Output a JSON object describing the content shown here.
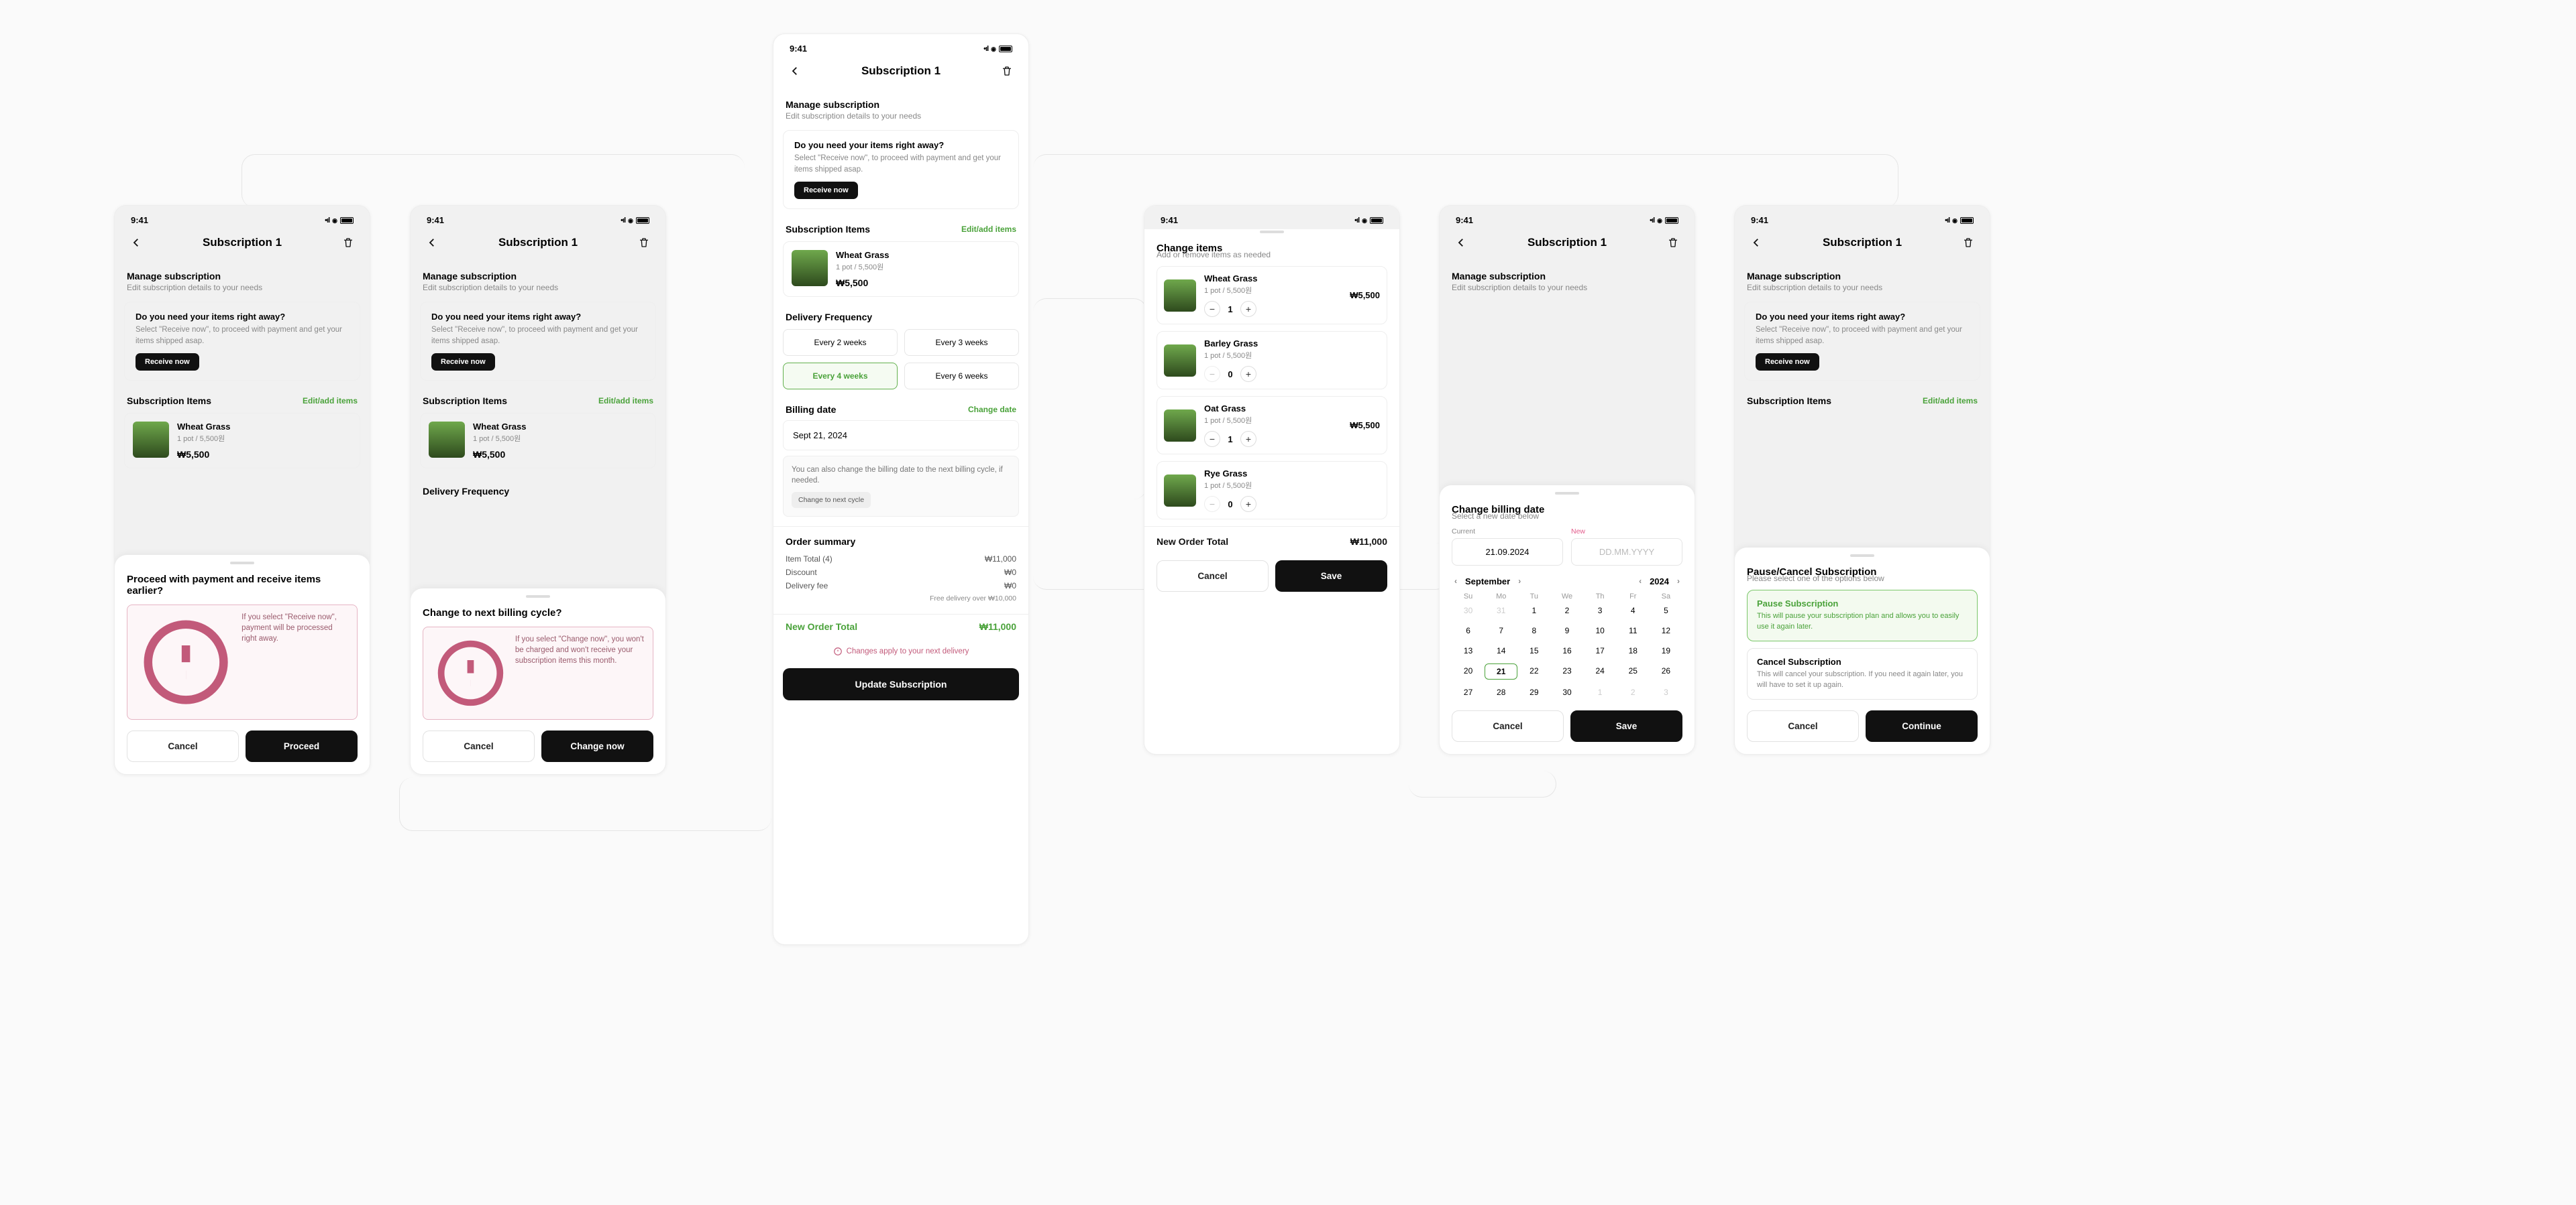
{
  "status_time": "9:41",
  "nav_title": "Subscription 1",
  "manage": {
    "title": "Manage subscription",
    "subtitle": "Edit subscription details to your needs"
  },
  "receive_now": {
    "title": "Do you need your items right away?",
    "body": "Select \"Receive now\", to proceed with payment and get your items shipped asap.",
    "cta": "Receive now"
  },
  "items_section": {
    "title": "Subscription Items",
    "action": "Edit/add items"
  },
  "product": {
    "name": "Wheat Grass",
    "meta": "1 pot / 5,500원",
    "price": "₩5,500"
  },
  "freq": {
    "title": "Delivery Frequency",
    "options": [
      "Every 2 weeks",
      "Every 3 weeks",
      "Every 4 weeks",
      "Every 6 weeks"
    ],
    "active_index": 2
  },
  "billing": {
    "title": "Billing date",
    "action": "Change date",
    "value": "Sept 21, 2024",
    "hint": "You can also change the billing date to the next billing cycle, if needed.",
    "chip": "Change to next cycle"
  },
  "summary": {
    "title": "Order summary",
    "item_total_label": "Item Total (4)",
    "item_total": "₩11,000",
    "discount_label": "Discount",
    "discount": "₩0",
    "delivery_label": "Delivery fee",
    "delivery": "₩0",
    "free_over": "Free delivery over ₩10,000",
    "new_total_label": "New Order Total",
    "new_total": "₩11,000"
  },
  "apply_notice": "Changes apply to your next delivery",
  "update_cta": "Update Subscription",
  "sheet_proceed": {
    "title": "Proceed with payment and receive items earlier?",
    "info": "If you select \"Receive now\", payment will be processed right away.",
    "cancel": "Cancel",
    "confirm": "Proceed"
  },
  "sheet_cycle": {
    "title": "Change to next billing cycle?",
    "info": "If you select \"Change now\", you won't be charged and won't receive your subscription items this month.",
    "cancel": "Cancel",
    "confirm": "Change now"
  },
  "sheet_items": {
    "title": "Change items",
    "subtitle": "Add or remove items as needed",
    "list": [
      {
        "name": "Wheat Grass",
        "meta": "1 pot / 5,500원",
        "qty": 1,
        "price": "₩5,500",
        "minus_disabled": false
      },
      {
        "name": "Barley Grass",
        "meta": "1 pot / 5,500원",
        "qty": 0,
        "price": "",
        "minus_disabled": true
      },
      {
        "name": "Oat Grass",
        "meta": "1 pot / 5,500원",
        "qty": 1,
        "price": "₩5,500",
        "minus_disabled": false
      },
      {
        "name": "Rye Grass",
        "meta": "1 pot / 5,500원",
        "qty": 0,
        "price": "",
        "minus_disabled": true
      }
    ],
    "total_label": "New Order Total",
    "total": "₩11,000",
    "cancel": "Cancel",
    "save": "Save"
  },
  "sheet_date": {
    "title": "Change billing date",
    "subtitle": "Select a new date below",
    "current_label": "Current",
    "current_value": "21.09.2024",
    "new_label": "New",
    "new_placeholder": "DD.MM.YYYY",
    "month": "September",
    "year": "2024",
    "dow": [
      "Su",
      "Mo",
      "Tu",
      "We",
      "Th",
      "Fr",
      "Sa"
    ],
    "leading_muted": [
      30,
      31
    ],
    "days": [
      1,
      2,
      3,
      4,
      5,
      6,
      7,
      8,
      9,
      10,
      11,
      12,
      13,
      14,
      15,
      16,
      17,
      18,
      19,
      20,
      21,
      22,
      23,
      24,
      25,
      26,
      27,
      28,
      29,
      30
    ],
    "trailing_muted": [
      1,
      2,
      3
    ],
    "selected": 21,
    "cancel": "Cancel",
    "save": "Save"
  },
  "sheet_pause": {
    "title": "Pause/Cancel Subscription",
    "subtitle": "Please select one of the options below",
    "opt1_t": "Pause Subscription",
    "opt1_s": "This will pause your subscription plan and allows you to easily use it again later.",
    "opt2_t": "Cancel Subscription",
    "opt2_s": "This will cancel your subscription. If you need it again later, you will have to set it up again.",
    "cancel": "Cancel",
    "continue": "Continue"
  }
}
